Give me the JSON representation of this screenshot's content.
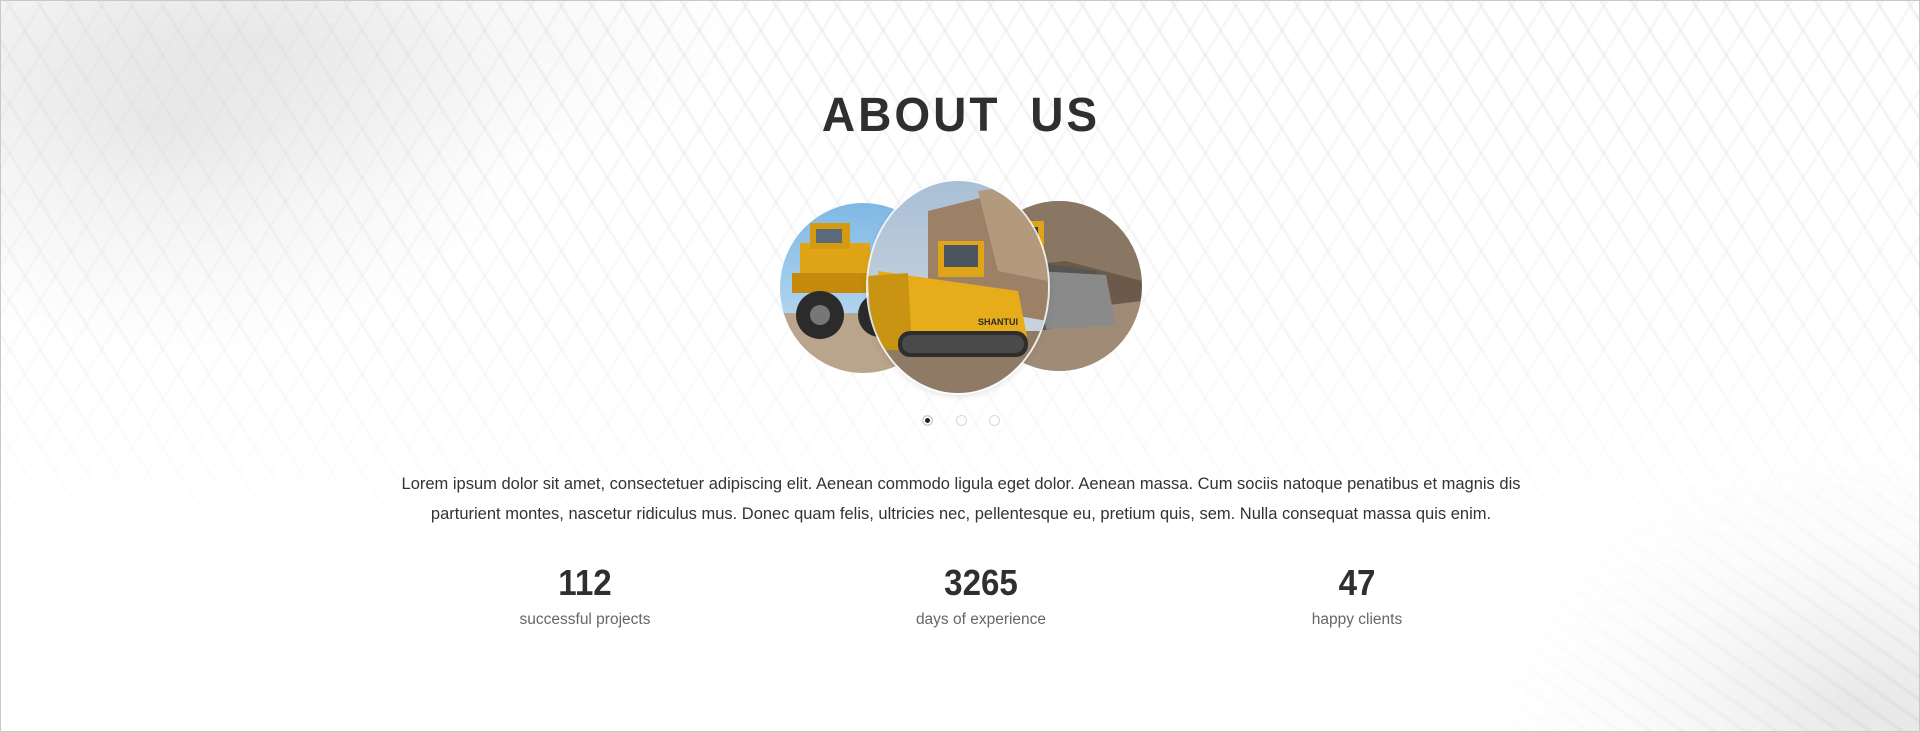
{
  "section": {
    "title": "ABOUT US",
    "carousel": {
      "slides": [
        "bulldozer-slide",
        "loader-slide",
        "excavator-slide"
      ],
      "active_index": 0,
      "image_text": "SHANTUI"
    },
    "description": "Lorem ipsum dolor sit amet, consectetuer adipiscing elit. Aenean commodo ligula eget dolor. Aenean massa. Cum sociis natoque penatibus et magnis dis parturient montes, nascetur ridiculus mus. Donec quam felis, ultricies nec, pellentesque eu, pretium quis, sem. Nulla consequat massa quis enim.",
    "stats": [
      {
        "value": "112",
        "label": "successful projects"
      },
      {
        "value": "3265",
        "label": "days of experience"
      },
      {
        "value": "47",
        "label": "happy clients"
      }
    ]
  },
  "colors": {
    "heading": "#2f2f2f",
    "text": "#333333",
    "muted": "#666666",
    "machine_yellow": "#e0a516",
    "sky_blue": "#9fcbe8"
  }
}
